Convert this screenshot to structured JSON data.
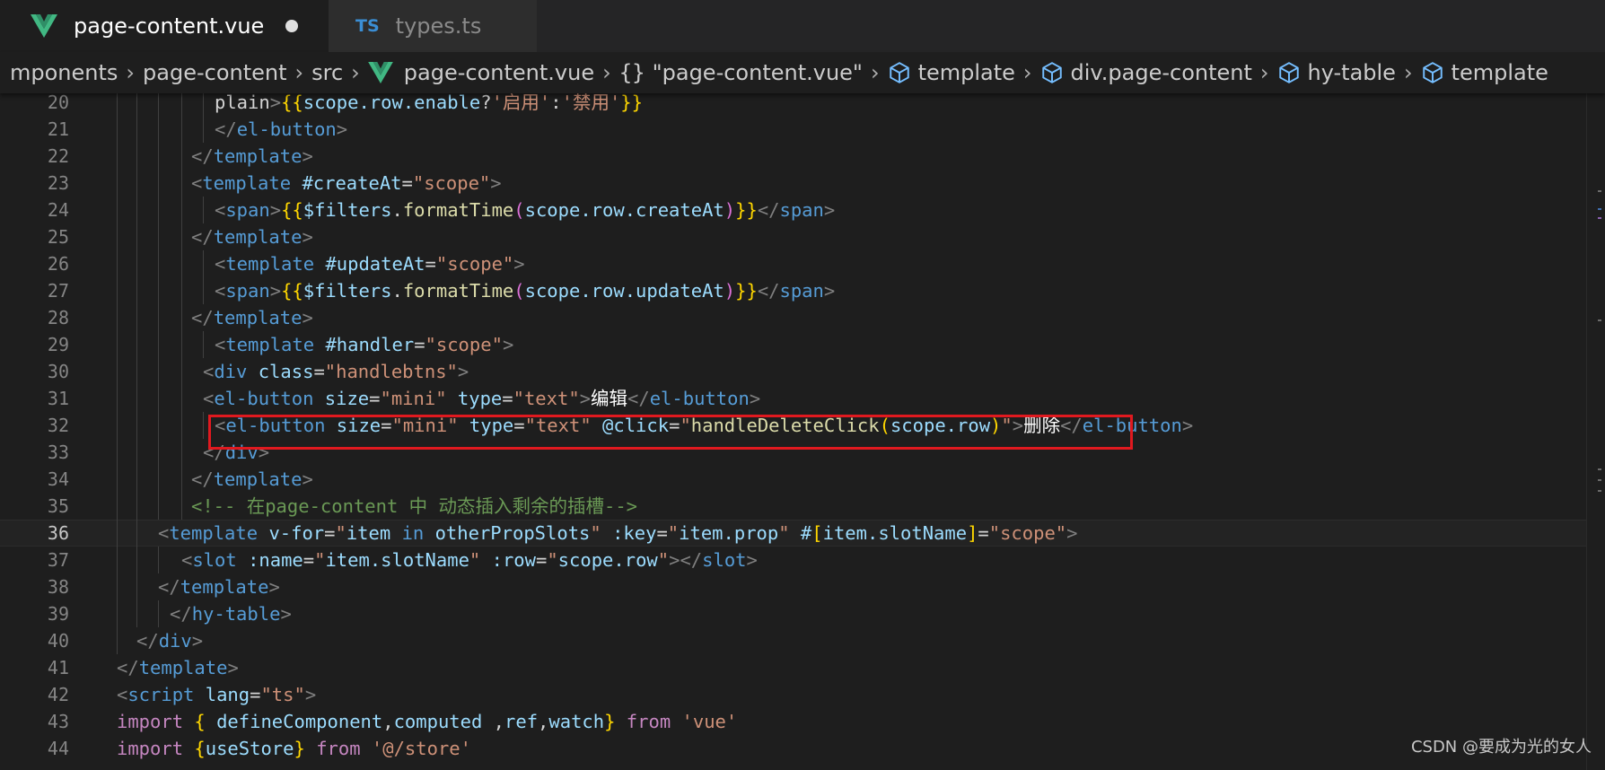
{
  "tabs": [
    {
      "label": "page-content.vue",
      "icon": "vue-icon",
      "active": true,
      "dirty": true
    },
    {
      "label": "types.ts",
      "icon": "ts-icon",
      "icon_text": "TS",
      "active": false,
      "dirty": false
    }
  ],
  "breadcrumb": {
    "items": [
      {
        "label": "mponents",
        "icon": ""
      },
      {
        "label": "page-content",
        "icon": ""
      },
      {
        "label": "src",
        "icon": ""
      },
      {
        "label": "page-content.vue",
        "icon": "vue-icon"
      },
      {
        "label": "\"page-content.vue\"",
        "icon": "braces-icon",
        "icon_text": "{}"
      },
      {
        "label": "template",
        "icon": "cube-icon"
      },
      {
        "label": "div.page-content",
        "icon": "cube-icon"
      },
      {
        "label": "hy-table",
        "icon": "cube-icon"
      },
      {
        "label": "template",
        "icon": "cube-icon"
      }
    ]
  },
  "colors": {
    "background": "#1e1e1e",
    "tag": "#569cd6",
    "attribute": "#9cdcfe",
    "string": "#ce9178",
    "comment": "#6a9955",
    "highlight_box": "#e0191f"
  },
  "editor": {
    "current_line": 36,
    "highlighted_line": 32,
    "lines": [
      {
        "num": "20",
        "tokens": [
          [
            "txt",
            "plain"
          ],
          [
            "punc",
            ">"
          ],
          [
            "brace",
            "{{"
          ],
          [
            "var",
            "scope.row.enable"
          ],
          [
            "txt",
            "?"
          ],
          [
            "str",
            "'启用'"
          ],
          [
            "txt",
            ":"
          ],
          [
            "str",
            "'禁用'"
          ],
          [
            "brace",
            "}}"
          ]
        ]
      },
      {
        "num": "21",
        "tokens": [
          [
            "punc",
            "</"
          ],
          [
            "tag",
            "el-button"
          ],
          [
            "punc",
            ">"
          ]
        ]
      },
      {
        "num": "22",
        "tokens": [
          [
            "punc",
            "</"
          ],
          [
            "tag",
            "template"
          ],
          [
            "punc",
            ">"
          ]
        ]
      },
      {
        "num": "23",
        "tokens": [
          [
            "punc",
            "<"
          ],
          [
            "tag",
            "template"
          ],
          [
            "txt",
            " "
          ],
          [
            "attr",
            "#createAt"
          ],
          [
            "txt",
            "="
          ],
          [
            "str",
            "\"scope\""
          ],
          [
            "punc",
            ">"
          ]
        ]
      },
      {
        "num": "24",
        "tokens": [
          [
            "punc",
            "<"
          ],
          [
            "tag",
            "span"
          ],
          [
            "punc",
            ">"
          ],
          [
            "brace",
            "{{"
          ],
          [
            "var",
            "$filters"
          ],
          [
            "txt",
            "."
          ],
          [
            "fn",
            "formatTime"
          ],
          [
            "brace2",
            "("
          ],
          [
            "var",
            "scope.row.createAt"
          ],
          [
            "brace2",
            ")"
          ],
          [
            "brace",
            "}}"
          ],
          [
            "punc",
            "</"
          ],
          [
            "tag",
            "span"
          ],
          [
            "punc",
            ">"
          ]
        ]
      },
      {
        "num": "25",
        "tokens": [
          [
            "punc",
            "</"
          ],
          [
            "tag",
            "template"
          ],
          [
            "punc",
            ">"
          ]
        ]
      },
      {
        "num": "26",
        "tokens": [
          [
            "punc",
            "<"
          ],
          [
            "tag",
            "template"
          ],
          [
            "txt",
            " "
          ],
          [
            "attr",
            "#updateAt"
          ],
          [
            "txt",
            "="
          ],
          [
            "str",
            "\"scope\""
          ],
          [
            "punc",
            ">"
          ]
        ]
      },
      {
        "num": "27",
        "tokens": [
          [
            "punc",
            "<"
          ],
          [
            "tag",
            "span"
          ],
          [
            "punc",
            ">"
          ],
          [
            "brace",
            "{{"
          ],
          [
            "var",
            "$filters"
          ],
          [
            "txt",
            "."
          ],
          [
            "fn",
            "formatTime"
          ],
          [
            "brace2",
            "("
          ],
          [
            "var",
            "scope.row.updateAt"
          ],
          [
            "brace2",
            ")"
          ],
          [
            "brace",
            "}}"
          ],
          [
            "punc",
            "</"
          ],
          [
            "tag",
            "span"
          ],
          [
            "punc",
            ">"
          ]
        ]
      },
      {
        "num": "28",
        "tokens": [
          [
            "punc",
            "</"
          ],
          [
            "tag",
            "template"
          ],
          [
            "punc",
            ">"
          ]
        ]
      },
      {
        "num": "29",
        "tokens": [
          [
            "punc",
            "<"
          ],
          [
            "tag",
            "template"
          ],
          [
            "txt",
            " "
          ],
          [
            "attr",
            "#handler"
          ],
          [
            "txt",
            "="
          ],
          [
            "str",
            "\"scope\""
          ],
          [
            "punc",
            ">"
          ]
        ]
      },
      {
        "num": "30",
        "tokens": [
          [
            "punc",
            "<"
          ],
          [
            "tag",
            "div"
          ],
          [
            "txt",
            " "
          ],
          [
            "attr",
            "class"
          ],
          [
            "txt",
            "="
          ],
          [
            "str",
            "\"handlebtns\""
          ],
          [
            "punc",
            ">"
          ]
        ]
      },
      {
        "num": "31",
        "tokens": [
          [
            "punc",
            "<"
          ],
          [
            "tag",
            "el-button"
          ],
          [
            "txt",
            " "
          ],
          [
            "attr",
            "size"
          ],
          [
            "txt",
            "="
          ],
          [
            "str",
            "\"mini\""
          ],
          [
            "txt",
            " "
          ],
          [
            "attr",
            "type"
          ],
          [
            "txt",
            "="
          ],
          [
            "str",
            "\"text\""
          ],
          [
            "punc",
            ">"
          ],
          [
            "white",
            "编辑"
          ],
          [
            "punc",
            "</"
          ],
          [
            "tag",
            "el-button"
          ],
          [
            "punc",
            ">"
          ]
        ]
      },
      {
        "num": "32",
        "tokens": [
          [
            "punc",
            "<"
          ],
          [
            "tag",
            "el-button"
          ],
          [
            "txt",
            " "
          ],
          [
            "attr",
            "size"
          ],
          [
            "txt",
            "="
          ],
          [
            "str",
            "\"mini\""
          ],
          [
            "txt",
            " "
          ],
          [
            "attr",
            "type"
          ],
          [
            "txt",
            "="
          ],
          [
            "str",
            "\"text\""
          ],
          [
            "txt",
            " "
          ],
          [
            "attr",
            "@click"
          ],
          [
            "txt",
            "="
          ],
          [
            "str",
            "\""
          ],
          [
            "fn",
            "handleDeleteClick"
          ],
          [
            "brace",
            "("
          ],
          [
            "var",
            "scope.row"
          ],
          [
            "brace",
            ")"
          ],
          [
            "str",
            "\""
          ],
          [
            "punc",
            ">"
          ],
          [
            "white",
            "删除"
          ],
          [
            "punc",
            "</"
          ],
          [
            "tag",
            "el-button"
          ],
          [
            "punc",
            ">"
          ]
        ]
      },
      {
        "num": "33",
        "tokens": [
          [
            "punc",
            "</"
          ],
          [
            "tag",
            "div"
          ],
          [
            "punc",
            ">"
          ]
        ]
      },
      {
        "num": "34",
        "tokens": [
          [
            "punc",
            "</"
          ],
          [
            "tag",
            "template"
          ],
          [
            "punc",
            ">"
          ]
        ]
      },
      {
        "num": "35",
        "tokens": [
          [
            "com",
            "<!-- 在page-content 中 动态插入剩余的插槽-->"
          ]
        ]
      },
      {
        "num": "36",
        "tokens": [
          [
            "punc",
            "<"
          ],
          [
            "tag",
            "template"
          ],
          [
            "txt",
            " "
          ],
          [
            "attr",
            "v-for"
          ],
          [
            "txt",
            "="
          ],
          [
            "str",
            "\""
          ],
          [
            "var",
            "item"
          ],
          [
            "txt",
            " "
          ],
          [
            "tag",
            "in"
          ],
          [
            "txt",
            " "
          ],
          [
            "var",
            "otherPropSlots"
          ],
          [
            "str",
            "\""
          ],
          [
            "txt",
            " "
          ],
          [
            "attr",
            ":key"
          ],
          [
            "txt",
            "="
          ],
          [
            "str",
            "\""
          ],
          [
            "var",
            "item.prop"
          ],
          [
            "str",
            "\""
          ],
          [
            "txt",
            " "
          ],
          [
            "attr",
            "#"
          ],
          [
            "brace",
            "["
          ],
          [
            "var",
            "item.slotName"
          ],
          [
            "brace",
            "]"
          ],
          [
            "txt",
            "="
          ],
          [
            "str",
            "\"scope\""
          ],
          [
            "punc",
            ">"
          ]
        ]
      },
      {
        "num": "37",
        "tokens": [
          [
            "punc",
            "<"
          ],
          [
            "tag",
            "slot"
          ],
          [
            "txt",
            " "
          ],
          [
            "attr",
            ":name"
          ],
          [
            "txt",
            "="
          ],
          [
            "str",
            "\""
          ],
          [
            "var",
            "item.slotName"
          ],
          [
            "str",
            "\""
          ],
          [
            "txt",
            " "
          ],
          [
            "attr",
            ":row"
          ],
          [
            "txt",
            "="
          ],
          [
            "str",
            "\""
          ],
          [
            "var",
            "scope.row"
          ],
          [
            "str",
            "\""
          ],
          [
            "punc",
            "></"
          ],
          [
            "tag",
            "slot"
          ],
          [
            "punc",
            ">"
          ]
        ]
      },
      {
        "num": "38",
        "tokens": [
          [
            "punc",
            "</"
          ],
          [
            "tag",
            "template"
          ],
          [
            "punc",
            ">"
          ]
        ]
      },
      {
        "num": "39",
        "tokens": [
          [
            "punc",
            "</"
          ],
          [
            "tag",
            "hy-table"
          ],
          [
            "punc",
            ">"
          ]
        ]
      },
      {
        "num": "40",
        "tokens": [
          [
            "punc",
            "</"
          ],
          [
            "tag",
            "div"
          ],
          [
            "punc",
            ">"
          ]
        ]
      },
      {
        "num": "41",
        "tokens": [
          [
            "punc",
            "</"
          ],
          [
            "tag",
            "template"
          ],
          [
            "punc",
            ">"
          ]
        ]
      },
      {
        "num": "42",
        "tokens": [
          [
            "punc",
            "<"
          ],
          [
            "tag",
            "script"
          ],
          [
            "txt",
            " "
          ],
          [
            "attr",
            "lang"
          ],
          [
            "txt",
            "="
          ],
          [
            "str",
            "\"ts\""
          ],
          [
            "punc",
            ">"
          ]
        ]
      },
      {
        "num": "43",
        "tokens": [
          [
            "kw",
            "import"
          ],
          [
            "txt",
            " "
          ],
          [
            "brace",
            "{"
          ],
          [
            "txt",
            " "
          ],
          [
            "var",
            "defineComponent"
          ],
          [
            "txt",
            ","
          ],
          [
            "var",
            "computed"
          ],
          [
            "txt",
            " ,"
          ],
          [
            "var",
            "ref"
          ],
          [
            "txt",
            ","
          ],
          [
            "var",
            "watch"
          ],
          [
            "brace",
            "}"
          ],
          [
            "txt",
            " "
          ],
          [
            "kw",
            "from"
          ],
          [
            "txt",
            " "
          ],
          [
            "str",
            "'vue'"
          ]
        ]
      },
      {
        "num": "44",
        "tokens": [
          [
            "kw",
            "import"
          ],
          [
            "txt",
            " "
          ],
          [
            "brace",
            "{"
          ],
          [
            "var",
            "useStore"
          ],
          [
            "brace",
            "}"
          ],
          [
            "txt",
            " "
          ],
          [
            "kw",
            "from"
          ],
          [
            "txt",
            " "
          ],
          [
            "str",
            "'@/store'"
          ]
        ]
      }
    ]
  },
  "watermark": "CSDN @要成为光的女人"
}
